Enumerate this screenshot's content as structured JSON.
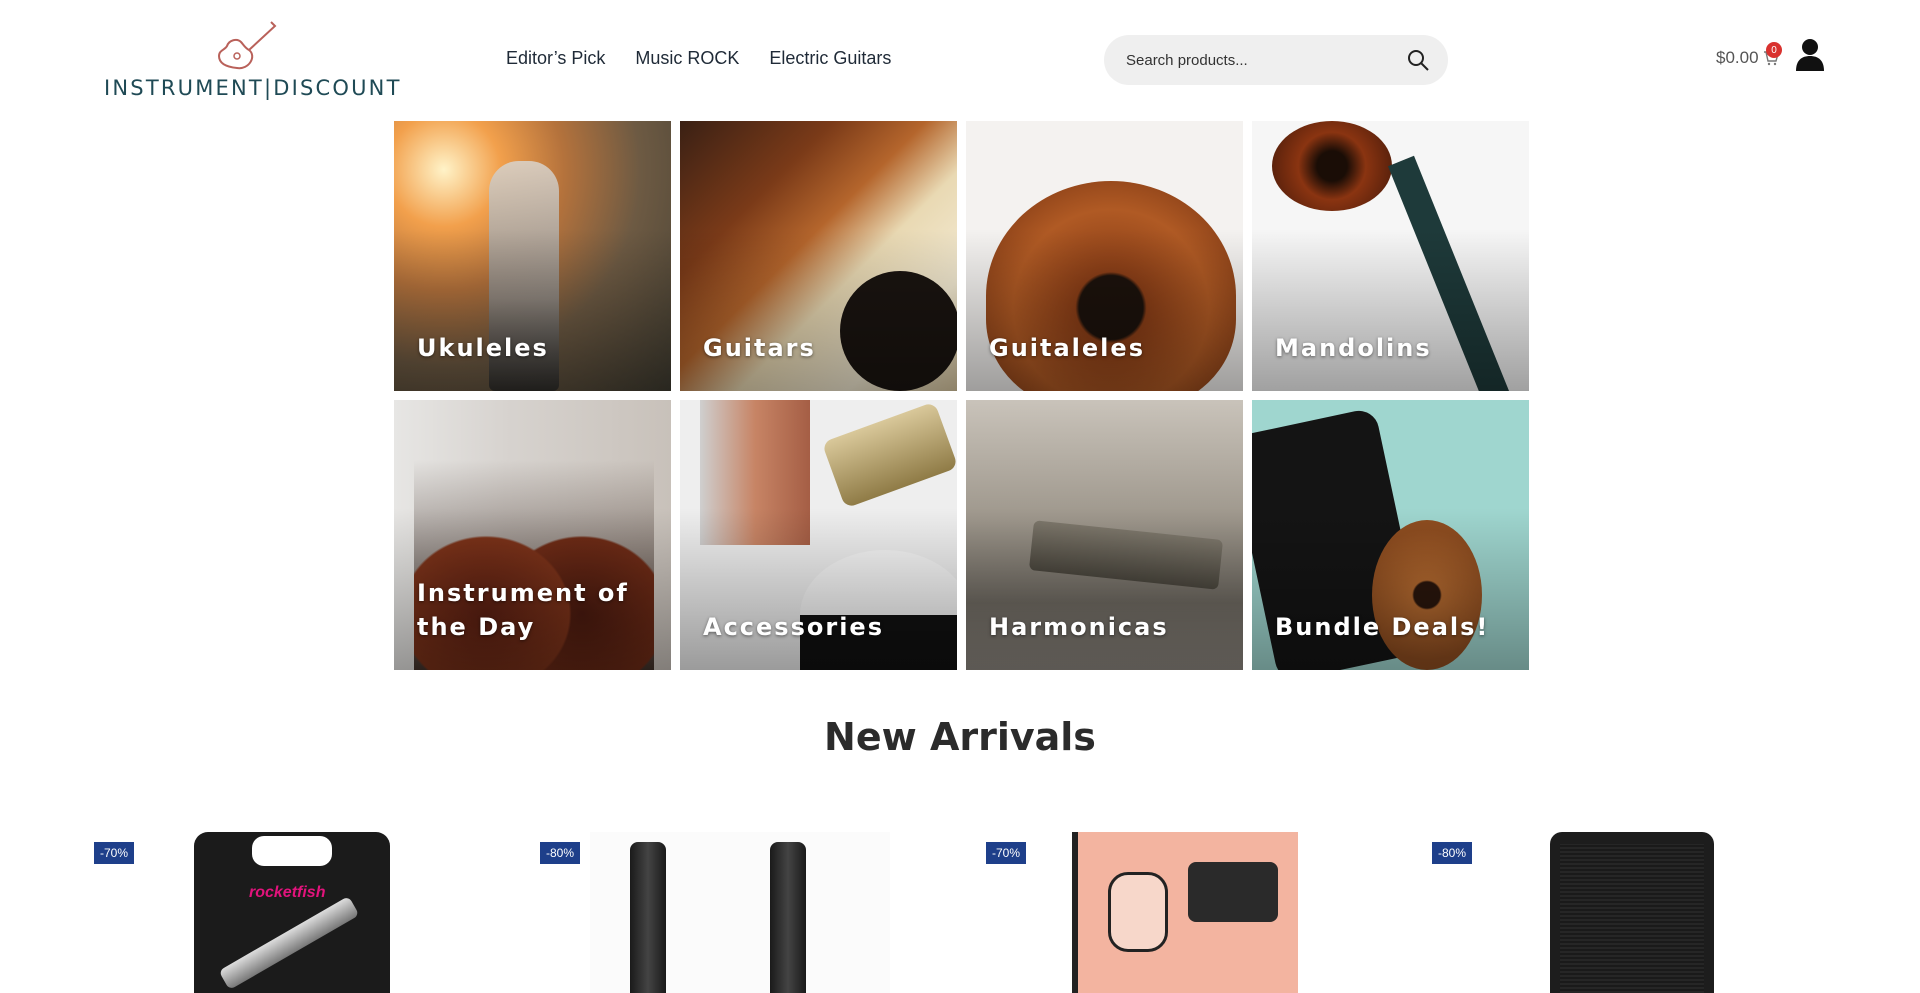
{
  "header": {
    "logo_text": "INSTRUMENT|DISCOUNT",
    "nav": [
      "Editor’s Pick",
      "Music ROCK",
      "Electric Guitars"
    ],
    "search_placeholder": "Search products...",
    "cart_amount": "$0.00",
    "cart_count": "0"
  },
  "categories": [
    {
      "label": "Ukuleles",
      "icon": "ukulele-photo"
    },
    {
      "label": "Guitars",
      "icon": "guitar-photo"
    },
    {
      "label": "Guitaleles",
      "icon": "guitalele-photo"
    },
    {
      "label": "Mandolins",
      "icon": "mandolin-photo"
    },
    {
      "label": "Instrument of the Day",
      "icon": "ukuleles-photo"
    },
    {
      "label": "Accessories",
      "icon": "accessories-photo"
    },
    {
      "label": "Harmonicas",
      "icon": "harmonica-photo"
    },
    {
      "label": "Bundle Deals!",
      "icon": "bundle-photo"
    }
  ],
  "new_arrivals": {
    "title": "New Arrivals",
    "products": [
      {
        "discount": "-70%",
        "image": "hdmi-cable-package"
      },
      {
        "discount": "-80%",
        "image": "microphone-pair"
      },
      {
        "discount": "-70%",
        "image": "manual-booklet"
      },
      {
        "discount": "-80%",
        "image": "speaker-cabinet"
      }
    ]
  },
  "colors": {
    "badge": "#1e3f8a",
    "cart_badge": "#d9322f",
    "logo": "#1f4a55"
  }
}
